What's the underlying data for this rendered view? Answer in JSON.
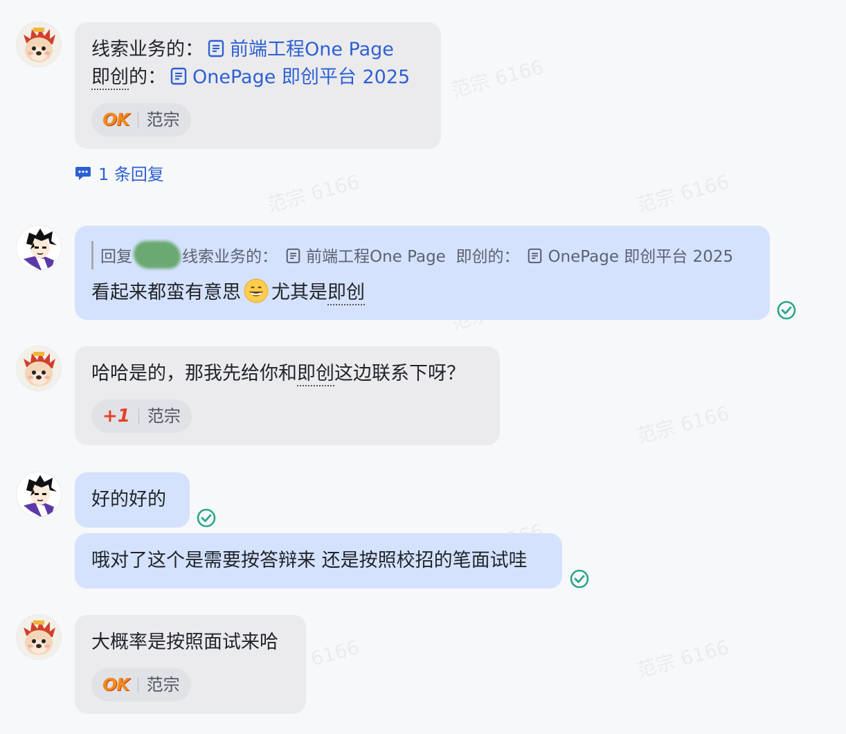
{
  "watermark_text": "范宗 6166",
  "messages": [
    {
      "line1_prefix": "线索业务的：",
      "line1_link": "前端工程One Page",
      "line2_prefix_a": "即创",
      "line2_prefix_b": "的：",
      "line2_link": "OnePage  即创平台 2025",
      "reaction_name": "范宗",
      "reaction_emoji": "OK"
    },
    {
      "thread_replies": "1 条回复"
    },
    {
      "quote_prefix": "回复",
      "quote_text": "线索业务的：",
      "quote_link1": "前端工程One Page",
      "quote_mid": "即创的：",
      "quote_link2": "OnePage 即创平台 2025",
      "text_a": "看起来都蛮有意思",
      "text_b": "尤其是",
      "text_c": "即创"
    },
    {
      "text_a": "哈哈是的，那我先给你和",
      "text_b": "即创",
      "text_c": "这边联系下呀？",
      "reaction_name": "范宗",
      "reaction_emoji": "+1"
    },
    {
      "text": "好的好的"
    },
    {
      "text": "哦对了这个是需要按答辩来 还是按照校招的笔面试哇"
    },
    {
      "text": "大概率是按照面试来哈",
      "reaction_name": "范宗",
      "reaction_emoji": "OK"
    }
  ],
  "colors": {
    "link": "#2d5fd3",
    "gray_bubble": "#ebebed",
    "blue_bubble": "#d5e2fd",
    "read_check": "#2aa586"
  }
}
